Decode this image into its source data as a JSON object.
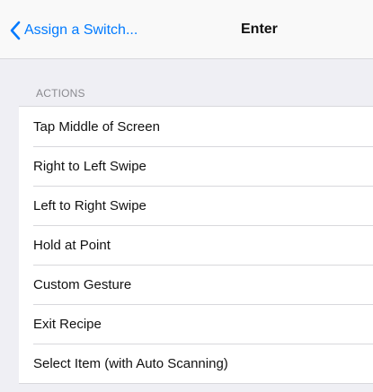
{
  "nav": {
    "back_label": "Assign a Switch...",
    "title": "Enter"
  },
  "section": {
    "header": "ACTIONS"
  },
  "actions": [
    {
      "label": "Tap Middle of Screen"
    },
    {
      "label": "Right to Left Swipe"
    },
    {
      "label": "Left to Right Swipe"
    },
    {
      "label": "Hold at Point"
    },
    {
      "label": "Custom Gesture"
    },
    {
      "label": "Exit Recipe"
    },
    {
      "label": "Select Item (with Auto Scanning)"
    }
  ],
  "colors": {
    "accent": "#007aff",
    "background": "#efeff4",
    "row_background": "#ffffff",
    "separator": "#d8d8dc",
    "section_header_text": "#8a8a8f"
  },
  "icons": {
    "back": "chevron-left-icon"
  }
}
